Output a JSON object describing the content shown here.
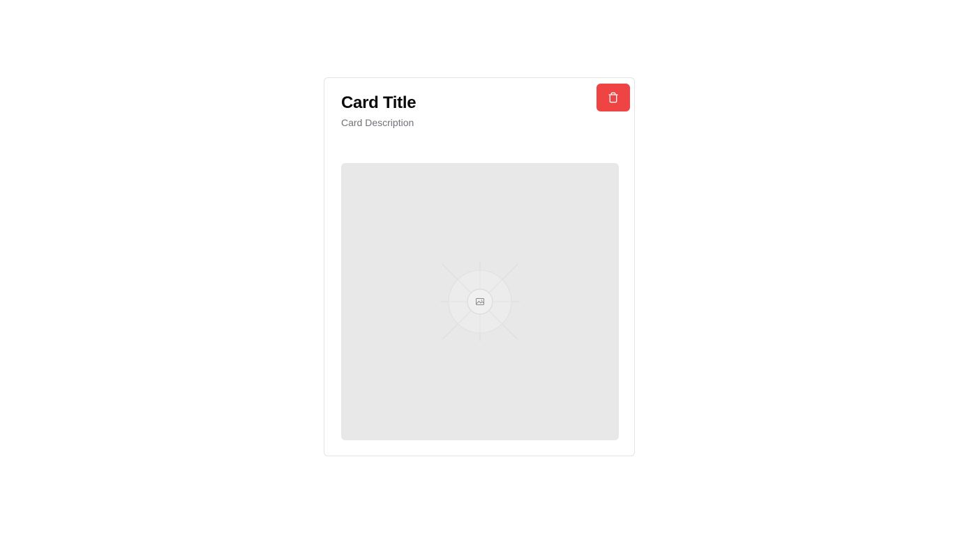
{
  "card": {
    "title": "Card Title",
    "description": "Card Description"
  },
  "delete_button": {
    "icon": "trash-icon",
    "color": "#ef4444"
  },
  "media": {
    "icon": "image-placeholder-icon",
    "background": "#e8e8e8"
  }
}
